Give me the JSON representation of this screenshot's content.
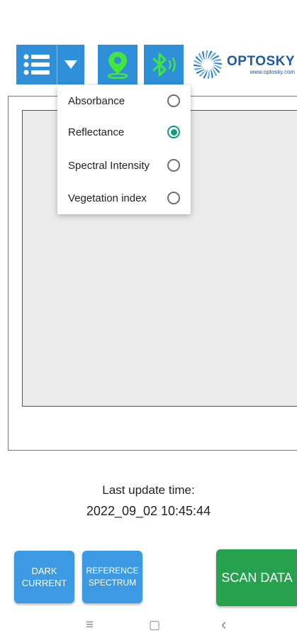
{
  "toolbar": {
    "menu_icon": "menu-icon",
    "dropdown_icon": "triangle-down-icon",
    "location_icon": "location-pin-icon",
    "bluetooth_icon": "bluetooth-icon",
    "colors": {
      "button": "#2f8fd8",
      "icon_green": "#3fe83a"
    }
  },
  "logo": {
    "name": "OPTOSKY",
    "url": "www.optosky.com"
  },
  "dropdown": {
    "items": [
      {
        "label": "Absorbance",
        "selected": false
      },
      {
        "label": "Reflectance",
        "selected": true
      },
      {
        "label": "Spectral Intensity",
        "selected": false
      },
      {
        "label": "Vegetation index",
        "selected": false
      }
    ]
  },
  "status": {
    "label": "Last update time:",
    "time": "2022_09_02 10:45:44"
  },
  "buttons": {
    "dark_line1": "DARK",
    "dark_line2": "CURRENT",
    "ref_line1": "REFERENCE",
    "ref_line2": "SPECTRUM",
    "scan": "SCAN DATA",
    "colors": {
      "blue": "#3d9ae2",
      "green": "#26a24e"
    }
  },
  "navbar": {
    "menu_glyph": "≡",
    "home_glyph": "▢",
    "back_glyph": "‹"
  }
}
